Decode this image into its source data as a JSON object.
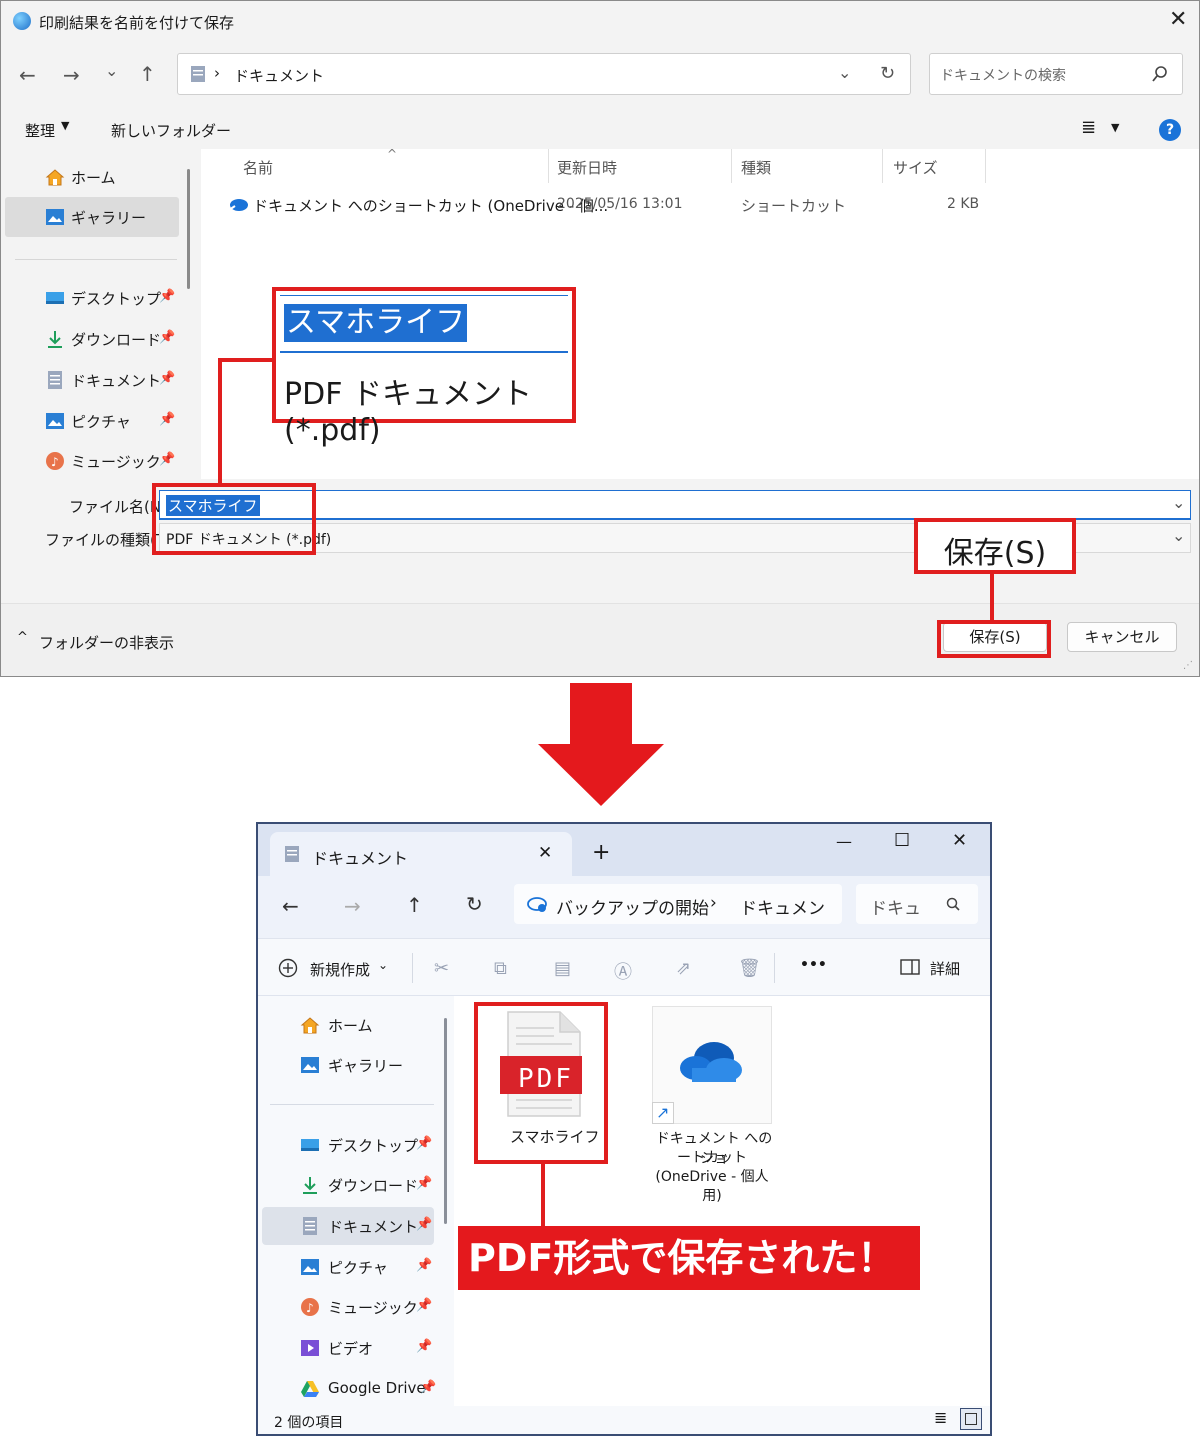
{
  "dialog": {
    "title": "印刷結果を名前を付けて保存",
    "close_symbol": "✕",
    "address": {
      "separator": "›",
      "location": "ドキュメント"
    },
    "search_placeholder": "ドキュメントの検索",
    "toolbar": {
      "organize": "整理",
      "new_folder": "新しいフォルダー"
    },
    "sidebar": {
      "top_items": [
        {
          "label": "ホーム",
          "icon": "home-icon"
        },
        {
          "label": "ギャラリー",
          "icon": "gallery-icon",
          "selected": true
        }
      ],
      "pinned_items": [
        {
          "label": "デスクトップ",
          "icon": "desktop-icon"
        },
        {
          "label": "ダウンロード",
          "icon": "download-icon"
        },
        {
          "label": "ドキュメント",
          "icon": "documents-icon"
        },
        {
          "label": "ピクチャ",
          "icon": "pictures-icon"
        },
        {
          "label": "ミュージック",
          "icon": "music-icon"
        }
      ]
    },
    "columns": {
      "name": "名前",
      "modified": "更新日時",
      "type": "種類",
      "size": "サイズ"
    },
    "files": [
      {
        "name": "ドキュメント へのショートカット (OneDrive - 個...",
        "modified": "2025/05/16 13:01",
        "type": "ショートカット",
        "size": "2 KB"
      }
    ],
    "filename_label": "ファイル名(N):",
    "filename_value": "スマホライフ",
    "filetype_label": "ファイルの種類(T):",
    "filetype_value": "PDF ドキュメント (*.pdf)",
    "hide_folders": "フォルダーの非表示",
    "save_button": "保存(S)",
    "cancel_button": "キャンセル"
  },
  "zoom_callout": {
    "filename": "スマホライフ",
    "filetype": "PDF ドキュメント (*.pdf)",
    "save": "保存(S)"
  },
  "explorer": {
    "tab_title": "ドキュメント",
    "tab_close": "✕",
    "new_tab": "+",
    "window_controls": {
      "minimize": "—",
      "maximize": "☐",
      "close": "✕"
    },
    "breadcrumb": [
      "バックアップの開始",
      "ドキュメン"
    ],
    "breadcrumb_sep": "›",
    "search_text": "ドキュ",
    "new_button": "新規作成",
    "more": "•••",
    "details": "詳細",
    "sidebar": {
      "top_items": [
        {
          "label": "ホーム",
          "icon": "home-icon"
        },
        {
          "label": "ギャラリー",
          "icon": "gallery-icon"
        }
      ],
      "pinned_items": [
        {
          "label": "デスクトップ",
          "icon": "desktop-icon"
        },
        {
          "label": "ダウンロード",
          "icon": "download-icon"
        },
        {
          "label": "ドキュメント",
          "icon": "documents-icon",
          "selected": true
        },
        {
          "label": "ピクチャ",
          "icon": "pictures-icon"
        },
        {
          "label": "ミュージック",
          "icon": "music-icon"
        },
        {
          "label": "ビデオ",
          "icon": "video-icon"
        },
        {
          "label": "Google Drive",
          "icon": "google-drive-icon"
        }
      ]
    },
    "files": [
      {
        "name": "スマホライフ",
        "badge": "PDF"
      },
      {
        "name_lines": [
          "ドキュメント へのショ",
          "ートカット",
          "(OneDrive - 個人",
          "用)"
        ]
      }
    ],
    "status": "2 個の項目"
  },
  "banner_text": "PDF形式で保存された！",
  "colors": {
    "highlight_red": "#e01e1e",
    "selection_blue": "#1f6fd1",
    "pdf_red": "#d9232a",
    "onedrive_blue": "#1a73d8"
  }
}
